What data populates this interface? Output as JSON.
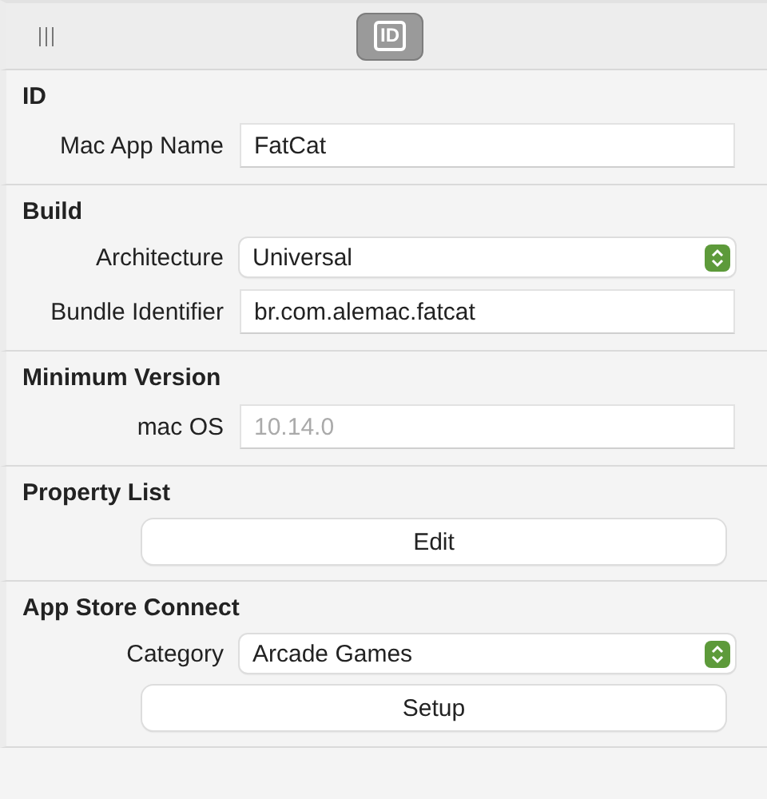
{
  "toolbar": {
    "tabs": [
      {
        "label": "ID",
        "selected": true
      }
    ]
  },
  "sections": [
    {
      "title": "ID",
      "rows": [
        {
          "kind": "text",
          "label": "Mac App Name",
          "value": "FatCat"
        }
      ]
    },
    {
      "title": "Build",
      "rows": [
        {
          "kind": "popup",
          "label": "Architecture",
          "value": "Universal"
        },
        {
          "kind": "text",
          "label": "Bundle Identifier",
          "value": "br.com.alemac.fatcat"
        }
      ]
    },
    {
      "title": "Minimum Version",
      "rows": [
        {
          "kind": "text",
          "label": "mac OS",
          "placeholder": "10.14.0"
        }
      ]
    },
    {
      "title": "Property List",
      "rows": [
        {
          "kind": "button",
          "label": "Edit"
        }
      ]
    },
    {
      "title": "App Store Connect",
      "rows": [
        {
          "kind": "popup",
          "label": "Category",
          "value": "Arcade Games"
        },
        {
          "kind": "button",
          "label": "Setup"
        }
      ]
    }
  ]
}
